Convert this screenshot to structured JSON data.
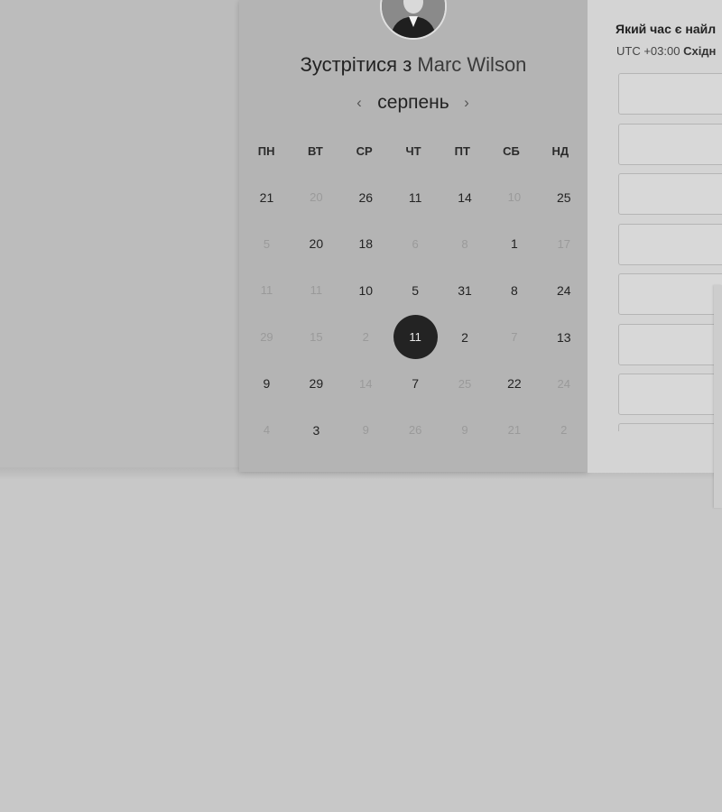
{
  "meeting": {
    "prefix": "Зустрітися з",
    "host": "Marc Wilson"
  },
  "calendar": {
    "month": "серпень",
    "prev_icon": "chevron-left-icon",
    "next_icon": "chevron-right-icon",
    "weekdays": [
      "ПН",
      "ВТ",
      "СР",
      "ЧТ",
      "ПТ",
      "СБ",
      "НД"
    ],
    "weeks": [
      [
        {
          "d": "21",
          "m": false
        },
        {
          "d": "20",
          "m": true
        },
        {
          "d": "26",
          "m": false
        },
        {
          "d": "11",
          "m": false
        },
        {
          "d": "14",
          "m": false
        },
        {
          "d": "10",
          "m": true
        },
        {
          "d": "25",
          "m": false
        }
      ],
      [
        {
          "d": "5",
          "m": true
        },
        {
          "d": "20",
          "m": false
        },
        {
          "d": "18",
          "m": false
        },
        {
          "d": "6",
          "m": true
        },
        {
          "d": "8",
          "m": true
        },
        {
          "d": "1",
          "m": false
        },
        {
          "d": "17",
          "m": true
        }
      ],
      [
        {
          "d": "11",
          "m": true
        },
        {
          "d": "11",
          "m": true
        },
        {
          "d": "10",
          "m": false
        },
        {
          "d": "5",
          "m": false
        },
        {
          "d": "31",
          "m": false
        },
        {
          "d": "8",
          "m": false
        },
        {
          "d": "24",
          "m": false
        }
      ],
      [
        {
          "d": "29",
          "m": true
        },
        {
          "d": "15",
          "m": true
        },
        {
          "d": "2",
          "m": true
        },
        {
          "d": "11",
          "m": false,
          "selected": true
        },
        {
          "d": "2",
          "m": false
        },
        {
          "d": "7",
          "m": true
        },
        {
          "d": "13",
          "m": false
        }
      ],
      [
        {
          "d": "9",
          "m": false
        },
        {
          "d": "29",
          "m": false
        },
        {
          "d": "14",
          "m": true
        },
        {
          "d": "7",
          "m": false
        },
        {
          "d": "25",
          "m": true
        },
        {
          "d": "22",
          "m": false
        },
        {
          "d": "24",
          "m": true
        }
      ],
      [
        {
          "d": "4",
          "m": true
        },
        {
          "d": "3",
          "m": false
        },
        {
          "d": "9",
          "m": true
        },
        {
          "d": "26",
          "m": true
        },
        {
          "d": "9",
          "m": true
        },
        {
          "d": "21",
          "m": true
        },
        {
          "d": "2",
          "m": true
        }
      ]
    ]
  },
  "time_panel": {
    "title": "Який час є найл",
    "tz_offset": "UTC +03:00",
    "tz_name": "Східн"
  },
  "colors": {
    "selected_day": "#232323",
    "muted_day": "#9a9a9a"
  }
}
